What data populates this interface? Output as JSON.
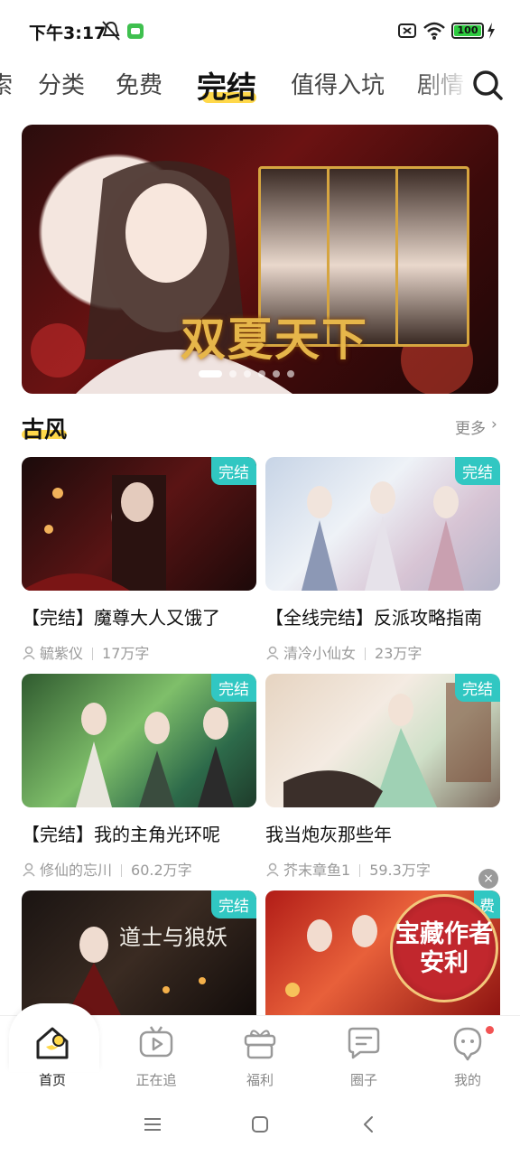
{
  "status_bar": {
    "time": "下午3:17",
    "battery": "100",
    "icons": [
      "bell-off-icon",
      "app-notification-icon",
      "sim-off-icon",
      "wifi-icon",
      "battery-icon",
      "charging-icon"
    ]
  },
  "top_tabs": {
    "items": [
      {
        "label": "索"
      },
      {
        "label": "分类"
      },
      {
        "label": "免费"
      },
      {
        "label": "完结",
        "active": true
      },
      {
        "label": "值得入坑"
      },
      {
        "label": "剧情"
      }
    ],
    "accent_color": "#ffd84a"
  },
  "banner": {
    "art_title": "双夏天下",
    "total_slides": 6,
    "active_slide": 1
  },
  "section": {
    "title": "古风",
    "more_label": "更多",
    "more_chevron": "›"
  },
  "cards": [
    {
      "badge": "完结",
      "title": "【完结】魔尊大人又饿了",
      "author": "毓紫仪",
      "words": "17万字"
    },
    {
      "badge": "完结",
      "title": "【全线完结】反派攻略指南",
      "author": "清冷小仙女",
      "words": "23万字"
    },
    {
      "badge": "完结",
      "title": "【完结】我的主角光环呢",
      "author": "修仙的忘川",
      "words": "60.2万字"
    },
    {
      "badge": "完结",
      "title": "我当炮灰那些年",
      "author": "芥末章鱼1",
      "words": "59.3万字"
    },
    {
      "badge": "完结",
      "art_text": "道士与狼妖"
    },
    {
      "badge": "费",
      "art_text": ""
    }
  ],
  "ad": {
    "close": "×",
    "line1": "宝藏作者",
    "line2": "安利"
  },
  "bottom_nav": {
    "items": [
      {
        "label": "首页",
        "icon": "home-icon",
        "active": true
      },
      {
        "label": "正在追",
        "icon": "tv-play-icon"
      },
      {
        "label": "福利",
        "icon": "gift-icon"
      },
      {
        "label": "圈子",
        "icon": "chat-bubble-icon"
      },
      {
        "label": "我的",
        "icon": "profile-icon",
        "has_dot": true
      }
    ]
  },
  "system_nav": [
    "menu-icon",
    "home-square-icon",
    "back-icon"
  ],
  "colors": {
    "accent_yellow": "#ffd84a",
    "badge_teal": "#31c7c2",
    "notification_red": "#f25353"
  }
}
